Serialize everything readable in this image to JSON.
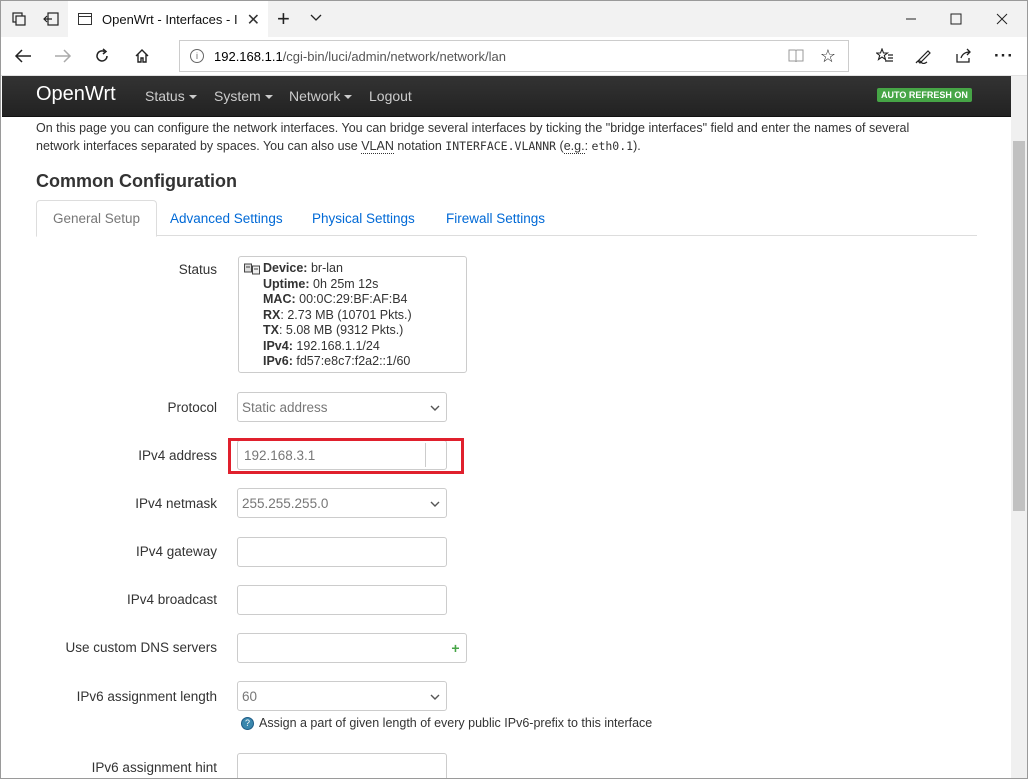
{
  "browser": {
    "tab_title": "OpenWrt - Interfaces - I",
    "url_host": "192.168.1.1",
    "url_path": "/cgi-bin/luci/admin/network/network/lan"
  },
  "header": {
    "brand": "OpenWrt",
    "menu": [
      "Status",
      "System",
      "Network",
      "Logout"
    ],
    "auto_refresh": "AUTO REFRESH ON",
    "auto_refresh_color": "#46a546"
  },
  "intro": {
    "line1": "On this page you can configure the network interfaces. You can bridge several interfaces by ticking the \"bridge interfaces\" field and enter the names of several",
    "line2_a": "network interfaces separated by spaces. You can also use ",
    "line2_vlan": "VLAN",
    "line2_b": " notation ",
    "line2_code1": "INTERFACE.VLANNR",
    "line2_c": " (",
    "line2_eg": "e.g.",
    "line2_d": ": ",
    "line2_code2": "eth0.1",
    "line2_e": ")."
  },
  "section": {
    "title": "Common Configuration",
    "tabs": [
      "General Setup",
      "Advanced Settings",
      "Physical Settings",
      "Firewall Settings"
    ]
  },
  "status": {
    "label": "Status",
    "device_label": "Device:",
    "device": "br-lan",
    "uptime_label": "Uptime:",
    "uptime": "0h 25m 12s",
    "mac_label": "MAC:",
    "mac": "00:0C:29:BF:AF:B4",
    "rx_label": "RX",
    "rx": ": 2.73 MB (10701 Pkts.)",
    "tx_label": "TX",
    "tx": ": 5.08 MB (9312 Pkts.)",
    "ipv4_label": "IPv4:",
    "ipv4": "192.168.1.1/24",
    "ipv6_label": "IPv6:",
    "ipv6": "fd57:e8c7:f2a2::1/60"
  },
  "form": {
    "protocol_label": "Protocol",
    "protocol_value": "Static address",
    "ipv4_address_label": "IPv4 address",
    "ipv4_address_value": "192.168.3.1",
    "netmask_label": "IPv4 netmask",
    "netmask_value": "255.255.255.0",
    "gateway_label": "IPv4 gateway",
    "gateway_value": "",
    "broadcast_label": "IPv4 broadcast",
    "broadcast_value": "",
    "dns_label": "Use custom DNS servers",
    "dns_value": "",
    "dns_add": "+",
    "ipv6_len_label": "IPv6 assignment length",
    "ipv6_len_value": "60",
    "ipv6_len_hint": "Assign a part of given length of every public IPv6-prefix to this interface",
    "ipv6_hint_label": "IPv6 assignment hint",
    "ipv6_hint_value": ""
  },
  "annotation_color": "#e0202d"
}
